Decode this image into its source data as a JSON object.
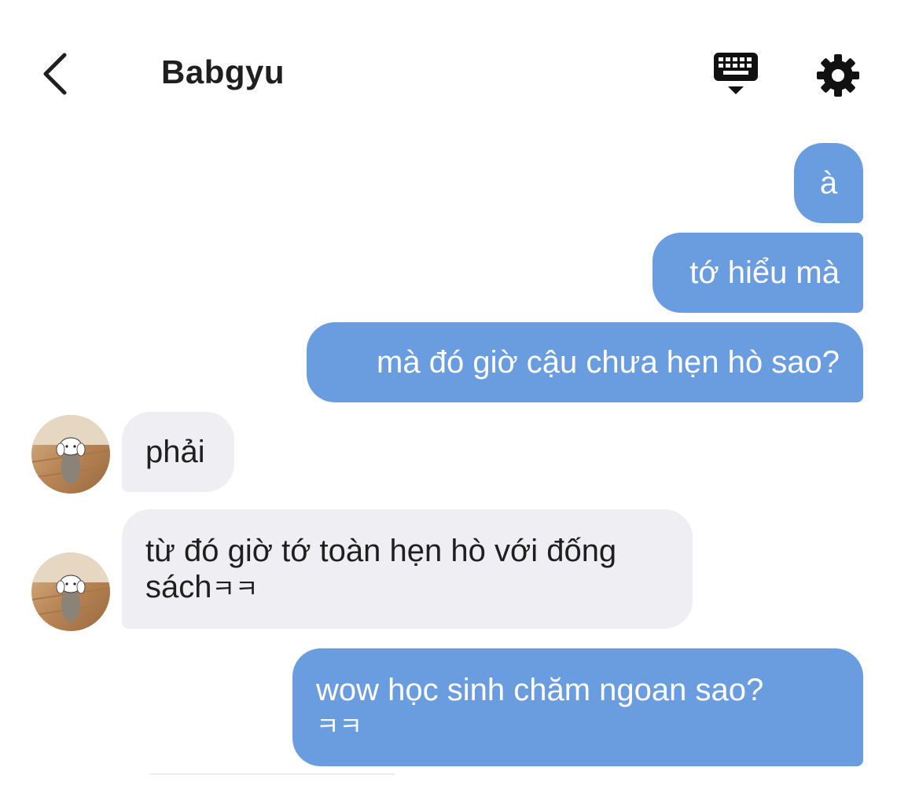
{
  "header": {
    "title": "Babgyu",
    "back_icon": "chevron-left-icon",
    "keyboard_icon": "keyboard-hide-icon",
    "settings_icon": "gear-icon"
  },
  "colors": {
    "outgoing_bubble": "#6a9de0",
    "incoming_bubble": "#efeff3",
    "title_text": "#1f1f1f"
  },
  "messages": [
    {
      "direction": "outgoing",
      "text": "à"
    },
    {
      "direction": "outgoing",
      "text": "tớ hiểu mà"
    },
    {
      "direction": "outgoing",
      "text": "mà đó giờ cậu chưa hẹn hò sao?"
    },
    {
      "direction": "incoming",
      "text": "phải"
    },
    {
      "direction": "incoming",
      "text_line1": "từ đó giờ tớ toàn hẹn hò với đống",
      "text_line2": "sách",
      "suffix": "ㅋㅋ"
    },
    {
      "direction": "outgoing",
      "text_line1": "wow học sinh chăm ngoan sao?",
      "suffix": "ㅋㅋ"
    }
  ]
}
